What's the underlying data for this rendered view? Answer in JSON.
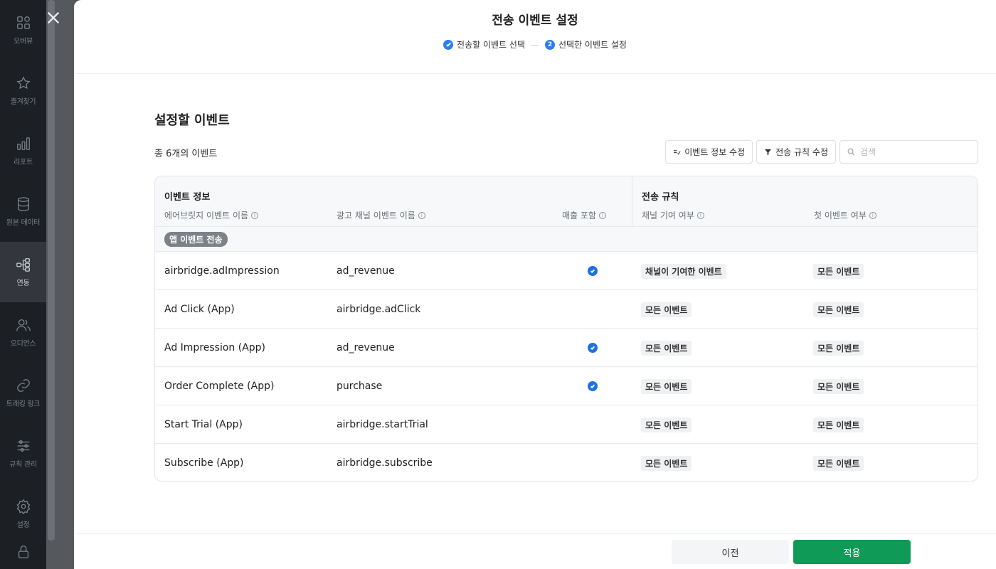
{
  "sidebar": {
    "items": [
      {
        "label": "오버뷰",
        "icon": "overview-icon"
      },
      {
        "label": "즐겨찾기",
        "icon": "star-icon"
      },
      {
        "label": "리포트",
        "icon": "bar-chart-icon"
      },
      {
        "label": "원본 데이터",
        "icon": "database-icon"
      },
      {
        "label": "연동",
        "icon": "integration-icon",
        "active": true
      },
      {
        "label": "오디언스",
        "icon": "audience-icon"
      },
      {
        "label": "트래킹 링크",
        "icon": "link-icon"
      },
      {
        "label": "규칙 관리",
        "icon": "sliders-icon"
      },
      {
        "label": "설정",
        "icon": "gear-icon"
      }
    ]
  },
  "modal": {
    "title": "전송 이벤트 설정",
    "steps": [
      {
        "label": "전송할 이벤트 선택",
        "state": "done"
      },
      {
        "label": "선택한 이벤트 설정",
        "number": "2",
        "state": "current"
      }
    ],
    "section_title": "설정할 이벤트",
    "event_count": "총 6개의 이벤트",
    "toolbar": {
      "edit_info_label": "이벤트 정보 수정",
      "edit_rule_label": "전송 규칙 수정",
      "search_placeholder": "검색"
    },
    "table": {
      "group_event_info": "이벤트 정보",
      "group_rules": "전송 규칙",
      "columns": {
        "airbridge_name": "에어브릿지 이벤트 이름",
        "channel_name": "광고 채널 이벤트 이름",
        "revenue": "매출 포함",
        "attribution": "채널 기여 여부",
        "first_event": "첫 이벤트 여부"
      },
      "group_chip": "앱 이벤트 전송",
      "rows": [
        {
          "airbridge": "airbridge.adImpression",
          "channel": "ad_revenue",
          "revenue": true,
          "attribution": "채널이 기여한 이벤트",
          "first": "모든 이벤트"
        },
        {
          "airbridge": "Ad Click (App)",
          "channel": "airbridge.adClick",
          "revenue": false,
          "attribution": "모든 이벤트",
          "first": "모든 이벤트"
        },
        {
          "airbridge": "Ad Impression (App)",
          "channel": "ad_revenue",
          "revenue": true,
          "attribution": "모든 이벤트",
          "first": "모든 이벤트"
        },
        {
          "airbridge": "Order Complete (App)",
          "channel": "purchase",
          "revenue": true,
          "attribution": "모든 이벤트",
          "first": "모든 이벤트"
        },
        {
          "airbridge": "Start Trial (App)",
          "channel": "airbridge.startTrial",
          "revenue": false,
          "attribution": "모든 이벤트",
          "first": "모든 이벤트"
        },
        {
          "airbridge": "Subscribe (App)",
          "channel": "airbridge.subscribe",
          "revenue": false,
          "attribution": "모든 이벤트",
          "first": "모든 이벤트"
        }
      ]
    },
    "footer": {
      "prev_label": "이전",
      "apply_label": "적용"
    }
  },
  "colors": {
    "accent": "#2a7ef0",
    "apply": "#0f9a57",
    "sidebar": "#1c1f24"
  }
}
